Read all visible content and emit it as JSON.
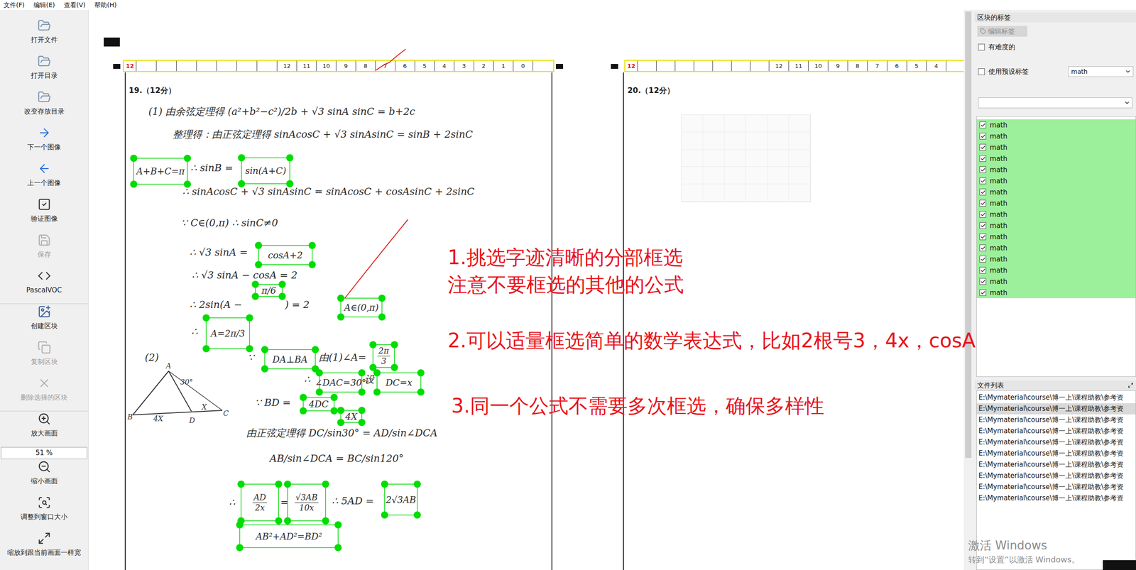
{
  "menu": [
    "文件(F)",
    "编辑(E)",
    "查看(V)",
    "帮助(H)"
  ],
  "toolbar": [
    {
      "label": "打开文件",
      "kind": "button",
      "disabled": false
    },
    {
      "label": "打开目录",
      "kind": "button",
      "disabled": false
    },
    {
      "label": "改变存放目录",
      "kind": "button",
      "disabled": false
    },
    {
      "label": "下一个图像",
      "kind": "button",
      "disabled": false
    },
    {
      "label": "上一个图像",
      "kind": "button",
      "disabled": false
    },
    {
      "label": "验证图像",
      "kind": "button",
      "disabled": false
    },
    {
      "label": "保存",
      "kind": "button",
      "disabled": true
    },
    {
      "label": "PascalVOC",
      "kind": "button",
      "disabled": false
    },
    {
      "label": "创建区块",
      "kind": "button",
      "disabled": false
    },
    {
      "label": "复制区块",
      "kind": "button",
      "disabled": true
    },
    {
      "label": "删除选择的区块",
      "kind": "button",
      "disabled": true
    },
    {
      "label": "放大画面",
      "kind": "button",
      "disabled": false
    },
    {
      "label": "51 %",
      "kind": "field",
      "disabled": false
    },
    {
      "label": "缩小画面",
      "kind": "button",
      "disabled": false
    },
    {
      "label": "调整到窗口大小",
      "kind": "button",
      "disabled": false
    },
    {
      "label": "缩放到跟当前画面一样宽",
      "kind": "button",
      "disabled": false
    }
  ],
  "document": {
    "left_strip": {
      "marker": "12",
      "numbers": [
        "12",
        "11",
        "10",
        "9",
        "8",
        "7",
        "6",
        "5",
        "4",
        "3",
        "2",
        "1",
        "0"
      ]
    },
    "right_strip": {
      "marker": "12",
      "numbers": [
        "12",
        "11",
        "10",
        "9",
        "8",
        "7",
        "6",
        "5",
        "4"
      ]
    },
    "left_title": "19.（12分）",
    "right_title": "20.（12分）",
    "lines": [
      "(1) 由余弦定理得 (a²+b²−c²)/2b + √3 sinA sinC = b+2c",
      "整理得：由正弦定理得 sinAcosC + √3 sinAsinC = sinB + 2sinC",
      "∴ sinB =",
      "∴ sinAcosC + √3 sinAsinC = sinAcosC + cosAsinC + 2sinC",
      "∵ C∈(0,π) ∴ sinC≠0",
      "∴ √3 sinA =",
      "∴ √3 sinA − cosA = 2",
      "∴ 2sin(A −",
      ") = 2",
      "∴",
      "(2)",
      "∵",
      "由(1)∠A=",
      "∴",
      "设",
      "∵ BD =",
      "由正弦定理得  DC/sin30° = AD/sin∠DCA",
      "AB/sin∠DCA = BC/sin120°",
      "∴",
      "=",
      "∴ 5AD ="
    ],
    "boxes": [
      {
        "kind": "text",
        "text": "A+B+C=π"
      },
      {
        "kind": "text",
        "text": "sin(A+C)"
      },
      {
        "kind": "text",
        "text": "cosA+2"
      },
      {
        "kind": "text",
        "text": "π/6"
      },
      {
        "kind": "text",
        "text": "A∈(0,π)"
      },
      {
        "kind": "text",
        "text": "A=2π/3"
      },
      {
        "kind": "text",
        "text": "DA⊥BA"
      },
      {
        "kind": "fraction",
        "num": "2π",
        "den": "3"
      },
      {
        "kind": "text",
        "text": "∠DAC=30°"
      },
      {
        "kind": "text",
        "text": "DC=x"
      },
      {
        "kind": "text",
        "text": "4DC"
      },
      {
        "kind": "text",
        "text": "4X"
      },
      {
        "kind": "fraction",
        "num": "AD",
        "den": "2x"
      },
      {
        "kind": "fraction",
        "num": "√3AB",
        "den": "10x"
      },
      {
        "kind": "text",
        "text": "2√3AB"
      },
      {
        "kind": "text",
        "text": "AB²+AD²=BD²"
      }
    ],
    "diagram_labels": [
      "A",
      "B",
      "D",
      "C",
      "4X",
      "X",
      "30°"
    ]
  },
  "notes": [
    "1.挑选字迹清晰的分部框选",
    "注意不要框选的其他的公式",
    "2.可以适量框选简单的数学表达式，比如2根号3，4x，cosA",
    "3.同一个公式不需要多次框选，确保多样性"
  ],
  "labels_panel": {
    "title": "区块的标签",
    "edit_button": {
      "label": "编辑标签",
      "disabled": true
    },
    "difficult": {
      "label": "有难度的",
      "checked": false
    },
    "use_default": {
      "label": "使用预设标签",
      "checked": false
    },
    "default_label": "math",
    "labels": [
      {
        "text": "math",
        "checked": true
      },
      {
        "text": "math",
        "checked": true
      },
      {
        "text": "math",
        "checked": true
      },
      {
        "text": "math",
        "checked": true
      },
      {
        "text": "math",
        "checked": true
      },
      {
        "text": "math",
        "checked": true
      },
      {
        "text": "math",
        "checked": true
      },
      {
        "text": "math",
        "checked": true
      },
      {
        "text": "math",
        "checked": true
      },
      {
        "text": "math",
        "checked": true
      },
      {
        "text": "math",
        "checked": true
      },
      {
        "text": "math",
        "checked": true
      },
      {
        "text": "math",
        "checked": true
      },
      {
        "text": "math",
        "checked": true
      },
      {
        "text": "math",
        "checked": true
      },
      {
        "text": "math",
        "checked": true
      }
    ]
  },
  "file_panel": {
    "title": "文件列表",
    "files": [
      {
        "path": "E:\\Mymaterial\\course\\博一上\\课程助教\\参考资",
        "selected": false
      },
      {
        "path": "E:\\Mymaterial\\course\\博一上\\课程助教\\参考资",
        "selected": true
      },
      {
        "path": "E:\\Mymaterial\\course\\博一上\\课程助教\\参考资",
        "selected": false
      },
      {
        "path": "E:\\Mymaterial\\course\\博一上\\课程助教\\参考资",
        "selected": false
      },
      {
        "path": "E:\\Mymaterial\\course\\博一上\\课程助教\\参考资",
        "selected": false
      },
      {
        "path": "E:\\Mymaterial\\course\\博一上\\课程助教\\参考资",
        "selected": false
      },
      {
        "path": "E:\\Mymaterial\\course\\博一上\\课程助教\\参考资",
        "selected": false
      },
      {
        "path": "E:\\Mymaterial\\course\\博一上\\课程助教\\参考资",
        "selected": false
      },
      {
        "path": "E:\\Mymaterial\\course\\博一上\\课程助教\\参考资",
        "selected": false
      },
      {
        "path": "E:\\Mymaterial\\course\\博一上\\课程助教\\参考资",
        "selected": false
      }
    ]
  },
  "watermark": {
    "title": "激活 Windows",
    "subtitle": "转到“设置”以激活 Windows。"
  }
}
